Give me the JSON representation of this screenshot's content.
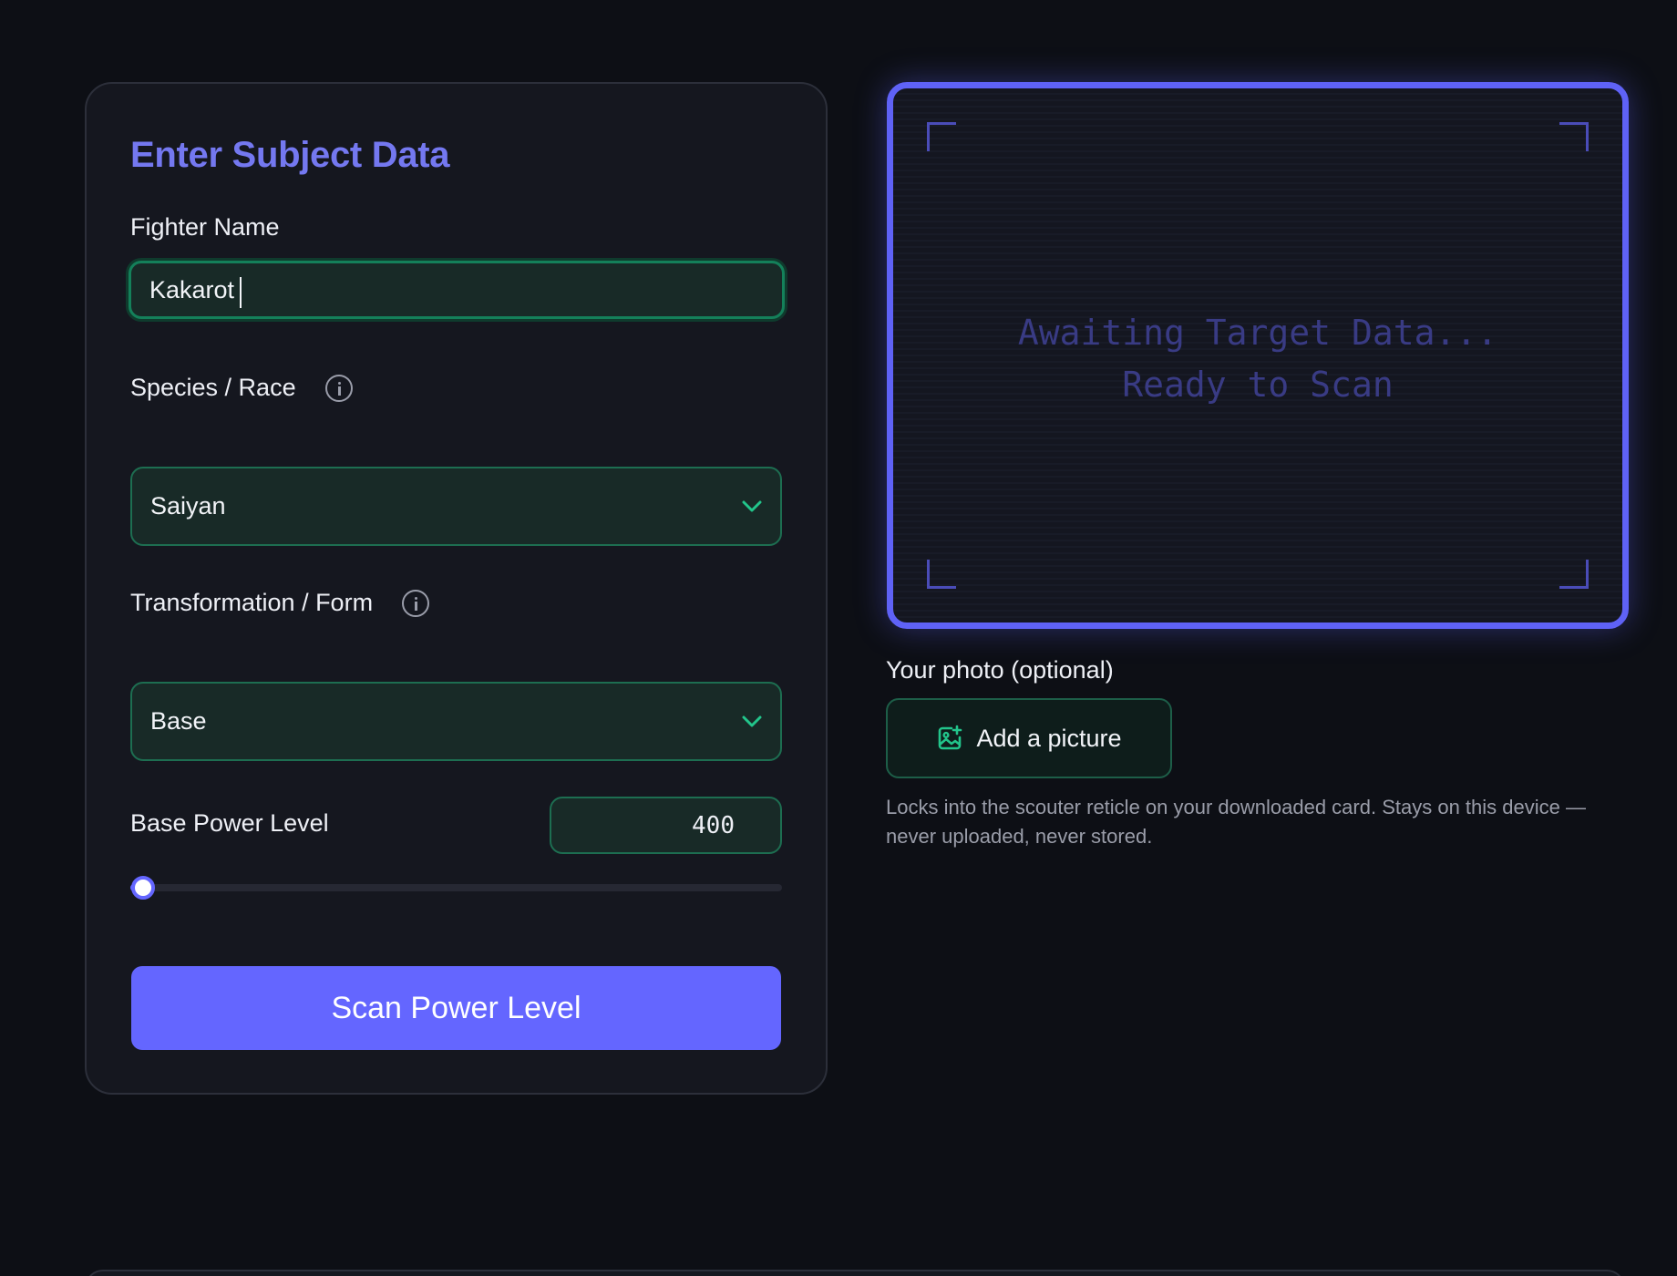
{
  "form": {
    "title": "Enter Subject Data",
    "fighter_name": {
      "label": "Fighter Name",
      "value": "Kakarot"
    },
    "species": {
      "label": "Species / Race",
      "selected": "Saiyan"
    },
    "transformation": {
      "label": "Transformation / Form",
      "selected": "Base"
    },
    "power_level": {
      "label": "Base Power Level",
      "value": "400",
      "slider_fraction": 0.02
    },
    "scan_button": "Scan Power Level"
  },
  "scanner": {
    "line1": "Awaiting Target Data...",
    "line2": "Ready to Scan"
  },
  "photo": {
    "label": "Your photo (optional)",
    "button": "Add a picture",
    "helper": "Locks into the scouter reticle on your downloaded card. Stays on this device — never uploaded, never stored."
  },
  "colors": {
    "accent": "#6466ff",
    "title": "#7478f0",
    "field_bg": "#182a27",
    "field_border": "#1d6e51",
    "icon_green": "#22c58b"
  },
  "icons": {
    "info": "info-icon",
    "chevron": "chevron-down-icon",
    "add_image": "image-plus-icon"
  }
}
